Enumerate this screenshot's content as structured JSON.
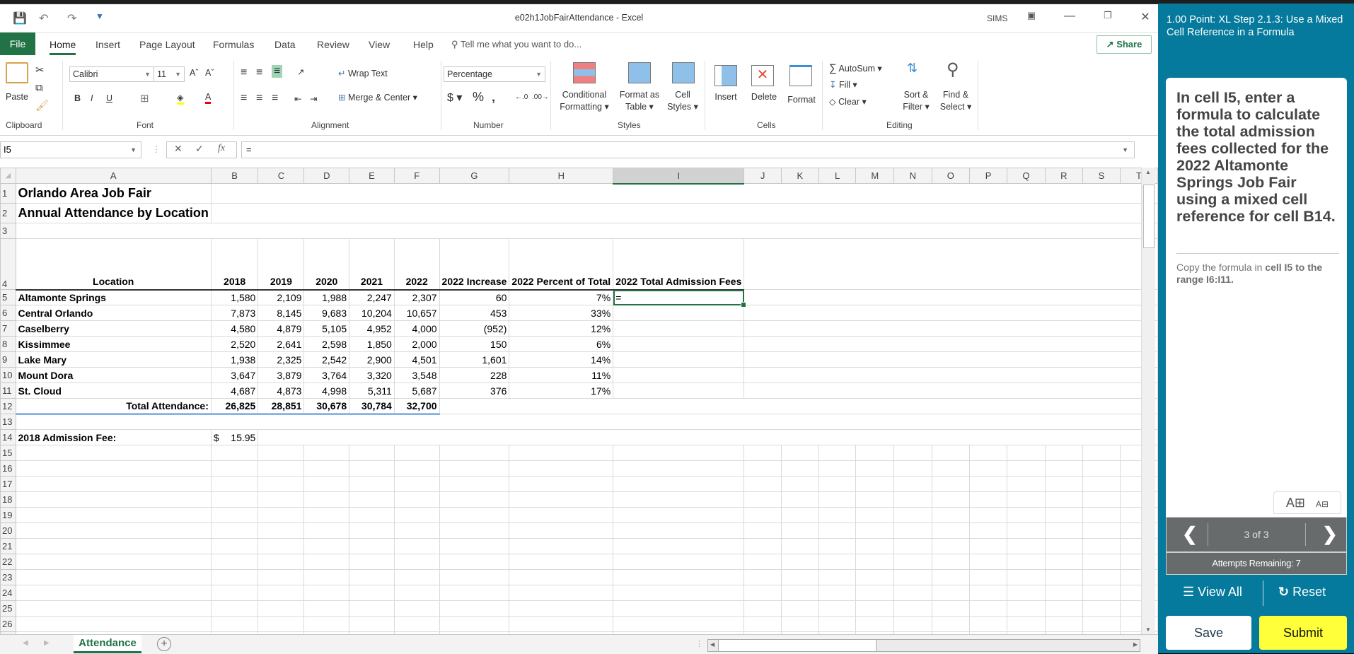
{
  "window": {
    "title": "e02h1JobFairAttendance - Excel",
    "user": "SIMS"
  },
  "tabs": [
    "File",
    "Home",
    "Insert",
    "Page Layout",
    "Formulas",
    "Data",
    "Review",
    "View",
    "Help"
  ],
  "tell_me_placeholder": "Tell me what you want to do...",
  "share_label": "Share",
  "ribbon": {
    "clipboard": {
      "paste": "Paste",
      "label": "Clipboard"
    },
    "font": {
      "name": "Calibri",
      "size": "11",
      "label": "Font"
    },
    "alignment": {
      "wrap": "Wrap Text",
      "merge": "Merge & Center",
      "label": "Alignment"
    },
    "number": {
      "format": "Percentage",
      "label": "Number"
    },
    "styles": {
      "conditional": "Conditional",
      "conditional2": "Formatting",
      "format_table": "Format as",
      "format_table2": "Table",
      "cell_styles": "Cell",
      "cell_styles2": "Styles",
      "label": "Styles"
    },
    "cells": {
      "insert": "Insert",
      "delete": "Delete",
      "format": "Format",
      "label": "Cells"
    },
    "editing": {
      "autosum": "AutoSum",
      "fill": "Fill",
      "clear": "Clear",
      "sort": "Sort &",
      "sort2": "Filter",
      "find": "Find &",
      "find2": "Select",
      "label": "Editing"
    }
  },
  "formula_bar": {
    "name_box": "I5",
    "formula": "="
  },
  "columns": [
    "A",
    "B",
    "C",
    "D",
    "E",
    "F",
    "G",
    "H",
    "I",
    "J",
    "K",
    "L",
    "M",
    "N",
    "O",
    "P",
    "Q",
    "R",
    "S",
    "T"
  ],
  "sheet": {
    "title1": "Orlando Area Job Fair",
    "title2": "Annual Attendance by Location",
    "headers": [
      "Location",
      "2018",
      "2019",
      "2020",
      "2021",
      "2022",
      "2022 Increase",
      "2022 Percent of Total",
      "2022 Total Admission Fees"
    ],
    "rows": [
      [
        "Altamonte Springs",
        "1,580",
        "2,109",
        "1,988",
        "2,247",
        "2,307",
        "60",
        "7%",
        "="
      ],
      [
        "Central Orlando",
        "7,873",
        "8,145",
        "9,683",
        "10,204",
        "10,657",
        "453",
        "33%",
        ""
      ],
      [
        "Caselberry",
        "4,580",
        "4,879",
        "5,105",
        "4,952",
        "4,000",
        "(952)",
        "12%",
        ""
      ],
      [
        "Kissimmee",
        "2,520",
        "2,641",
        "2,598",
        "1,850",
        "2,000",
        "150",
        "6%",
        ""
      ],
      [
        "Lake Mary",
        "1,938",
        "2,325",
        "2,542",
        "2,900",
        "4,501",
        "1,601",
        "14%",
        ""
      ],
      [
        "Mount Dora",
        "3,647",
        "3,879",
        "3,764",
        "3,320",
        "3,548",
        "228",
        "11%",
        ""
      ],
      [
        "St. Cloud",
        "4,687",
        "4,873",
        "4,998",
        "5,311",
        "5,687",
        "376",
        "17%",
        ""
      ]
    ],
    "totals": [
      "Total Attendance:",
      "26,825",
      "28,851",
      "30,678",
      "30,784",
      "32,700"
    ],
    "fee_label": "2018 Admission Fee:",
    "fee_currency": "$",
    "fee_value": "15.95",
    "tab_name": "Attendance"
  },
  "sidebar": {
    "title": "1.00 Point: XL Step 2.1.3: Use a Mixed Cell Reference in a Formula",
    "instruction": "In cell I5, enter a formula to calculate the total admission fees collected for the 2022 Altamonte Springs Job Fair using a mixed cell reference for cell B14.",
    "next_prefix": "Copy the formula in ",
    "next_bold": "cell I5 to the range I6:I11.",
    "page": "3 of 3",
    "attempts": "Attempts Remaining: 7",
    "view_all": "View All",
    "reset": "Reset",
    "save": "Save",
    "submit": "Submit",
    "accent": "#057a9c",
    "submit_color": "#ffff3a"
  }
}
